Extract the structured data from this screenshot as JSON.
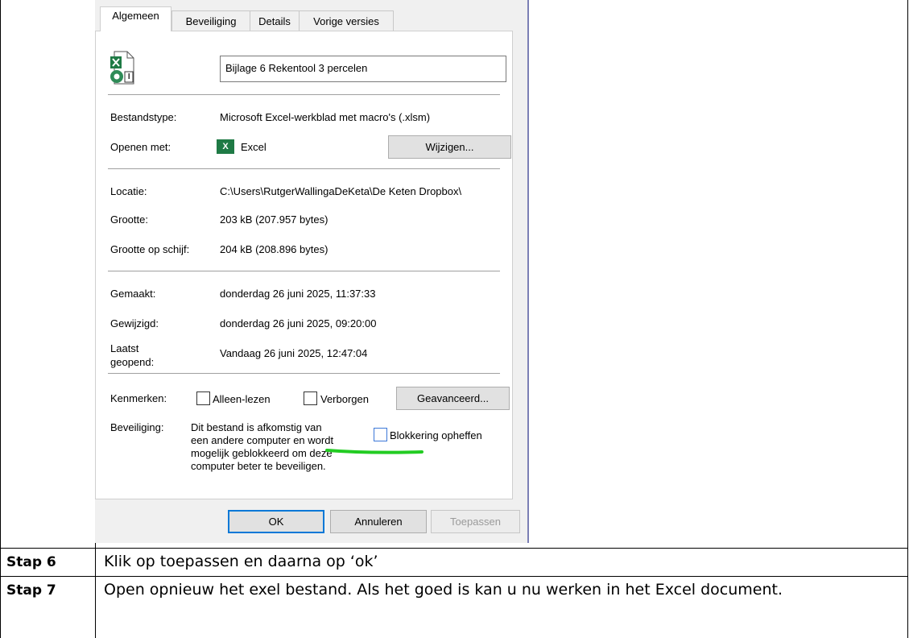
{
  "dialog": {
    "tabs": [
      "Algemeen",
      "Beveiliging",
      "Details",
      "Vorige versies"
    ],
    "file_name": "Bijlage 6 Rekentool 3 percelen",
    "labels": {
      "type": "Bestandstype:",
      "opens_with": "Openen met:",
      "location": "Locatie:",
      "size": "Grootte:",
      "size_on_disk": "Grootte op schijf:",
      "created": "Gemaakt:",
      "modified": "Gewijzigd:",
      "accessed_1": "Laatst",
      "accessed_2": "geopend:",
      "attributes": "Kenmerken:",
      "security": "Beveiliging:"
    },
    "values": {
      "type": "Microsoft Excel-werkblad met macro's (.xlsm)",
      "opens_with": "Excel",
      "location": "C:\\Users\\RutgerWallingaDeKeta\\De Keten Dropbox\\",
      "size": "203 kB (207.957 bytes)",
      "size_on_disk": "204 kB (208.896 bytes)",
      "created": "donderdag 26 juni 2025, 11:37:33",
      "modified": "donderdag 26 juni 2025, 09:20:00",
      "accessed": "Vandaag 26 juni 2025, 12:47:04"
    },
    "buttons": {
      "change": "Wijzigen...",
      "advanced": "Geavanceerd...",
      "ok": "OK",
      "cancel": "Annuleren",
      "apply": "Toepassen"
    },
    "checkboxes": {
      "readonly": "Alleen-lezen",
      "hidden": "Verborgen",
      "unblock": "Blokkering opheffen"
    },
    "security_text": [
      "Dit bestand is afkomstig van",
      "een andere computer en wordt",
      "mogelijk geblokkeerd om deze",
      "computer beter te beveiligen."
    ],
    "icons": {
      "file": "excel-macro-file-icon",
      "app": "excel-app-icon",
      "excel_glyph": "X"
    },
    "highlight_color": "#22cc22"
  },
  "steps": [
    {
      "label": "Stap 6",
      "text": "Klik op toepassen en daarna op ‘ok’"
    },
    {
      "label": "Stap 7",
      "text": "Open opnieuw het exel bestand. Als het goed is kan u nu werken in het Excel document."
    }
  ]
}
